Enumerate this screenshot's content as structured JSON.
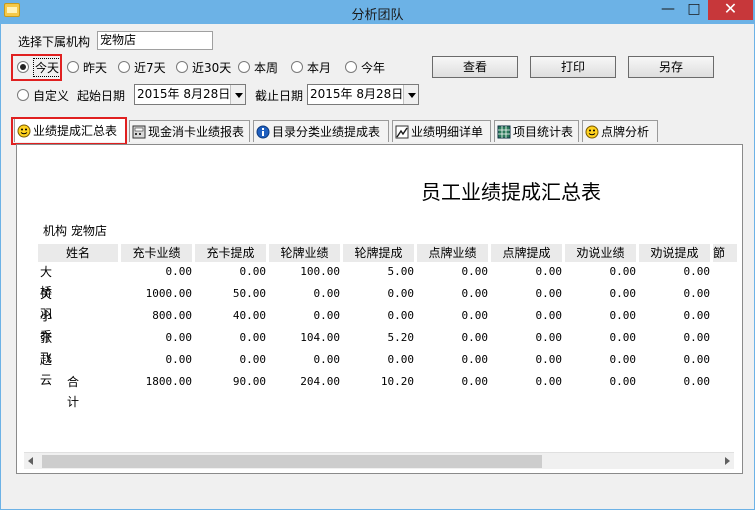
{
  "window": {
    "title": "分析团队",
    "min_label": "—",
    "max_label": "□",
    "close_label": "✕"
  },
  "filter": {
    "org_label": "选择下属机构",
    "org_value": "宠物店",
    "ranges": [
      {
        "label": "今天",
        "selected": true
      },
      {
        "label": "昨天",
        "selected": false
      },
      {
        "label": "近7天",
        "selected": false
      },
      {
        "label": "近30天",
        "selected": false
      },
      {
        "label": "本周",
        "selected": false
      },
      {
        "label": "本月",
        "selected": false
      },
      {
        "label": "今年",
        "selected": false
      }
    ],
    "custom_label": "自定义",
    "start_label": "起始日期",
    "start_date": "2015年  8月28日",
    "end_label": "截止日期",
    "end_date": "2015年  8月28日"
  },
  "buttons": {
    "view": "查看",
    "print": "打印",
    "save_as": "另存"
  },
  "tabs": [
    {
      "label": "业绩提成汇总表",
      "icon": "smiley-icon",
      "active": true
    },
    {
      "label": "现金消卡业绩报表",
      "icon": "calculator-icon",
      "active": false
    },
    {
      "label": "目录分类业绩提成表",
      "icon": "info-icon",
      "active": false
    },
    {
      "label": "业绩明细详单",
      "icon": "chart-icon",
      "active": false
    },
    {
      "label": "项目统计表",
      "icon": "grid-icon",
      "active": false
    },
    {
      "label": "点牌分析",
      "icon": "smiley-icon",
      "active": false
    }
  ],
  "report": {
    "title": "员工业绩提成汇总表",
    "org_line": "机构 宠物店",
    "columns": [
      "姓名",
      "充卡业绩",
      "充卡提成",
      "轮牌业绩",
      "轮牌提成",
      "点牌业绩",
      "点牌提成",
      "劝说业绩",
      "劝说提成",
      "節"
    ],
    "rows": [
      {
        "name": "大桥",
        "values": [
          "0.00",
          "0.00",
          "100.00",
          "5.00",
          "0.00",
          "0.00",
          "0.00",
          "0.00"
        ]
      },
      {
        "name": "关羽",
        "values": [
          "1000.00",
          "50.00",
          "0.00",
          "0.00",
          "0.00",
          "0.00",
          "0.00",
          "0.00"
        ]
      },
      {
        "name": "小乔",
        "values": [
          "800.00",
          "40.00",
          "0.00",
          "0.00",
          "0.00",
          "0.00",
          "0.00",
          "0.00"
        ]
      },
      {
        "name": "张飞",
        "values": [
          "0.00",
          "0.00",
          "104.00",
          "5.20",
          "0.00",
          "0.00",
          "0.00",
          "0.00"
        ]
      },
      {
        "name": "赵云",
        "values": [
          "0.00",
          "0.00",
          "0.00",
          "0.00",
          "0.00",
          "0.00",
          "0.00",
          "0.00"
        ]
      },
      {
        "name": "合计",
        "values": [
          "1800.00",
          "90.00",
          "204.00",
          "10.20",
          "0.00",
          "0.00",
          "0.00",
          "0.00"
        ]
      }
    ]
  },
  "colors": {
    "titlebar": "#6cb2e6",
    "close": "#c7373a",
    "highlight": "#e02020"
  }
}
